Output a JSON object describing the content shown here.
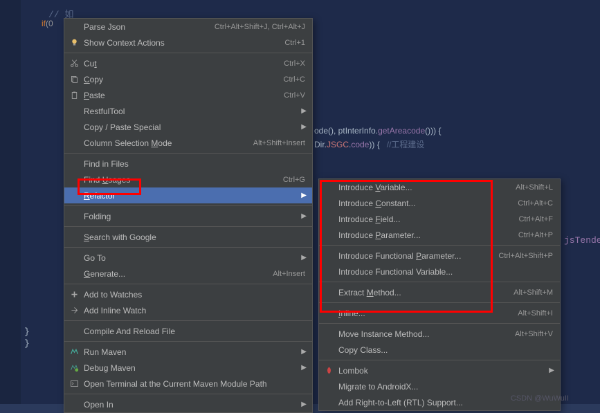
{
  "code": {
    "l1": "// 如",
    "l2a": "if",
    "l2b": "(0",
    "snippet1a": "ode(), ptInterInfo.",
    "snippet1b": "getAreacode",
    "snippet1c": "())) {",
    "snippet2a": "Dir.",
    "snippet2b": "JSGC",
    "snippet2c": ".",
    "snippet2d": "code",
    "snippet2e": ")) {   ",
    "snippet2f": "//工程建设",
    "snippet3": "jsTenderD"
  },
  "mainMenu": [
    {
      "label": "Parse Json",
      "shortcut": "Ctrl+Alt+Shift+J, Ctrl+Alt+J",
      "icon": ""
    },
    {
      "label": "Show Context Actions",
      "shortcut": "Ctrl+1",
      "icon": "bulb",
      "uline": ""
    },
    {
      "sep": true
    },
    {
      "label": "Cut",
      "shortcut": "Ctrl+X",
      "icon": "cut",
      "uline": "t"
    },
    {
      "label": "Copy",
      "shortcut": "Ctrl+C",
      "icon": "copy",
      "uline": "C"
    },
    {
      "label": "Paste",
      "shortcut": "Ctrl+V",
      "icon": "paste",
      "uline": "P"
    },
    {
      "label": "RestfulTool",
      "arrow": true
    },
    {
      "label": "Copy / Paste Special",
      "arrow": true
    },
    {
      "label": "Column Selection Mode",
      "shortcut": "Alt+Shift+Insert",
      "uline": "M"
    },
    {
      "sep": true
    },
    {
      "label": "Find in Files"
    },
    {
      "label": "Find Usages",
      "shortcut": "Ctrl+G",
      "uline": "U"
    },
    {
      "label": "Refactor",
      "arrow": true,
      "hl": true,
      "uline": "R"
    },
    {
      "sep": true
    },
    {
      "label": "Folding",
      "arrow": true
    },
    {
      "sep": true
    },
    {
      "label": "Search with Google",
      "uline": "S"
    },
    {
      "sep": true
    },
    {
      "label": "Go To",
      "arrow": true
    },
    {
      "label": "Generate...",
      "shortcut": "Alt+Insert",
      "uline": "G"
    },
    {
      "sep": true
    },
    {
      "label": "Add to Watches",
      "icon": "watch"
    },
    {
      "label": "Add Inline Watch",
      "icon": "inline"
    },
    {
      "sep": true
    },
    {
      "label": "Compile And Reload File"
    },
    {
      "sep": true
    },
    {
      "label": "Run Maven",
      "arrow": true,
      "icon": "maven"
    },
    {
      "label": "Debug Maven",
      "arrow": true,
      "icon": "maven-debug"
    },
    {
      "label": "Open Terminal at the Current Maven Module Path",
      "icon": "terminal"
    },
    {
      "sep": true
    },
    {
      "label": "Open In",
      "arrow": true
    }
  ],
  "subMenu": [
    {
      "label": "Introduce Variable...",
      "shortcut": "Alt+Shift+L",
      "uline": "V"
    },
    {
      "label": "Introduce Constant...",
      "shortcut": "Ctrl+Alt+C",
      "uline": "C"
    },
    {
      "label": "Introduce Field...",
      "shortcut": "Ctrl+Alt+F",
      "uline": "F"
    },
    {
      "label": "Introduce Parameter...",
      "shortcut": "Ctrl+Alt+P",
      "uline": "P"
    },
    {
      "sep": true
    },
    {
      "label": "Introduce Functional Parameter...",
      "shortcut": "Ctrl+Alt+Shift+P",
      "uline": "P"
    },
    {
      "label": "Introduce Functional Variable..."
    },
    {
      "sep": true
    },
    {
      "label": "Extract Method...",
      "shortcut": "Alt+Shift+M",
      "uline": "M"
    },
    {
      "sep": true
    },
    {
      "label": "Inline...",
      "shortcut": "Alt+Shift+I",
      "uline": "I"
    },
    {
      "sep": true
    },
    {
      "label": "Move Instance Method...",
      "shortcut": "Alt+Shift+V"
    },
    {
      "label": "Copy Class..."
    },
    {
      "sep": true
    },
    {
      "label": "Lombok",
      "arrow": true,
      "icon": "lombok"
    },
    {
      "label": "Migrate to AndroidX..."
    },
    {
      "label": "Add Right-to-Left (RTL) Support..."
    }
  ],
  "watermark": "CSDN @WuWuII"
}
